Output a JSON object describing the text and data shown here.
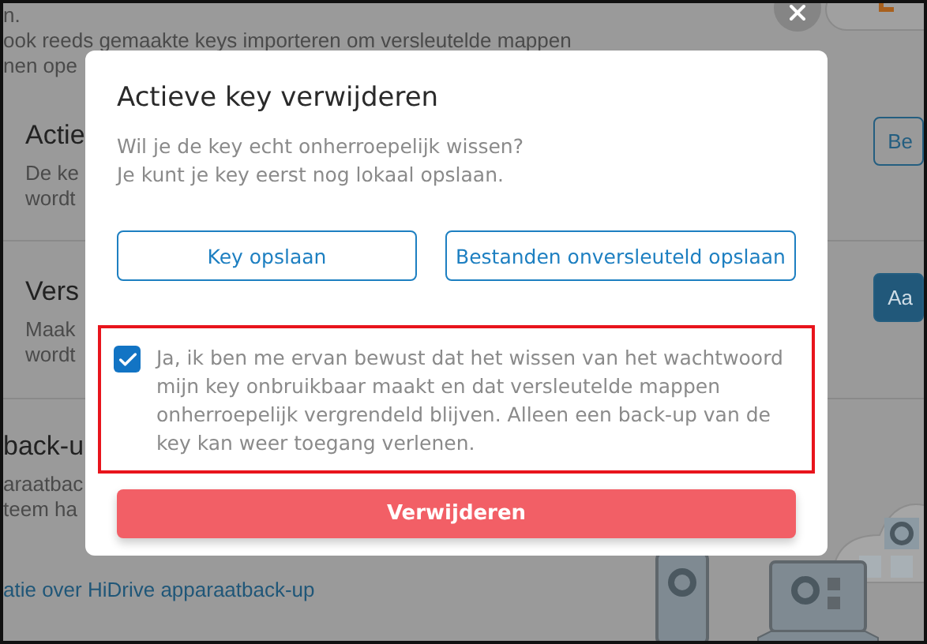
{
  "background": {
    "intro_lines": [
      "n.",
      "ook reeds gemaakte keys importeren om versleutelde mappen",
      "nen ope"
    ],
    "sections": [
      {
        "title": "Actie",
        "lines": [
          "De ke",
          "wordt"
        ],
        "button": {
          "label": "Be",
          "kind": "outline"
        }
      },
      {
        "title": "Vers",
        "lines": [
          "Maak",
          "wordt"
        ],
        "button": {
          "label": "Aa",
          "kind": "filled"
        }
      },
      {
        "title": "back-u",
        "lines": [
          "araatbac",
          "teem ha"
        ]
      }
    ],
    "link": "atie over HiDrive apparaatback-up"
  },
  "dialog": {
    "title": "Actieve key verwijderen",
    "message_lines": [
      "Wil je de key echt onherroepelijk wissen?",
      "Je kunt je key eerst nog lokaal opslaan."
    ],
    "buttons": [
      "Key opslaan",
      "Bestanden onversleuteld opslaan"
    ],
    "confirm": {
      "checked": true,
      "highlighted": true,
      "text": "Ja, ik ben me ervan bewust dat het wissen van het wachtwoord mijn key onbruikbaar maakt en dat versleutelde mappen onherroepelijk vergrendeld blijven. Alleen een back-up van de key kan weer toegang verlenen."
    },
    "delete_button": "Verwijderen"
  }
}
